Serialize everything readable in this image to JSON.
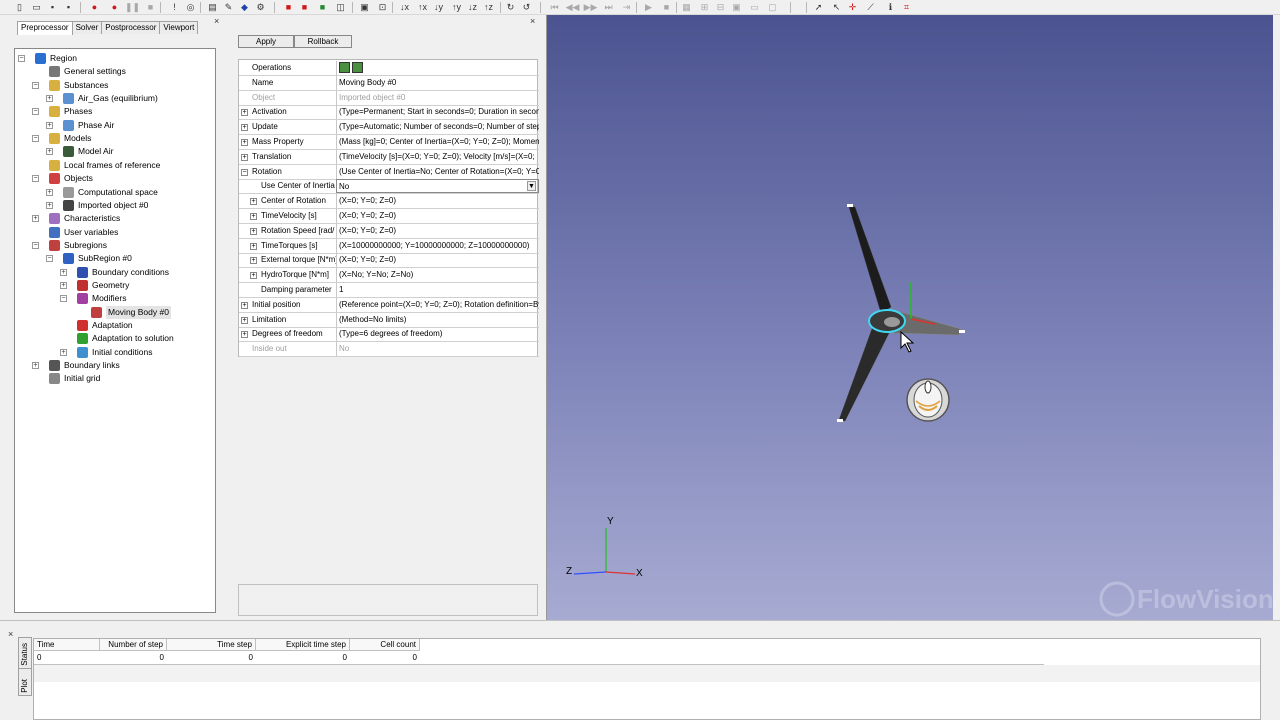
{
  "toolbar": {
    "icons": [
      "new-file",
      "open-folder",
      "save",
      "save-all",
      "stop-red",
      "record",
      "pause",
      "stop",
      "help",
      "globe",
      "copy",
      "tools",
      "cube-blue",
      "settings",
      "red-box",
      "red-box-2",
      "green-box",
      "layers",
      "frame",
      "zoom-fit",
      "x-minus",
      "x-plus",
      "y-minus",
      "y-plus",
      "z-minus",
      "z-plus",
      "rotate-x",
      "rotate-y",
      "first",
      "prev",
      "next",
      "last",
      "fast-forward",
      "play",
      "stop-play",
      "grid",
      "in",
      "out",
      "camera",
      "monitor",
      "window",
      "cursor",
      "pointer",
      "probe",
      "line-tool",
      "info",
      "pixel"
    ]
  },
  "left_panel": {
    "tabs": [
      {
        "label": "Preprocessor",
        "active": true
      },
      {
        "label": "Solver",
        "active": false
      },
      {
        "label": "Postprocessor",
        "active": false
      },
      {
        "label": "Viewport",
        "active": false
      }
    ],
    "tree": [
      {
        "label": "Region",
        "icon": "region-icon",
        "level": 0,
        "expander": "-"
      },
      {
        "label": "General settings",
        "icon": "settings-icon",
        "level": 1,
        "expander": ""
      },
      {
        "label": "Substances",
        "icon": "folder-icon",
        "level": 1,
        "expander": "-"
      },
      {
        "label": "Air_Gas (equilibrium)",
        "icon": "substance-icon",
        "level": 2,
        "expander": "+"
      },
      {
        "label": "Phases",
        "icon": "folder-icon",
        "level": 1,
        "expander": "-"
      },
      {
        "label": "Phase Air",
        "icon": "phase-icon",
        "level": 2,
        "expander": "+"
      },
      {
        "label": "Models",
        "icon": "folder-icon",
        "level": 1,
        "expander": "-"
      },
      {
        "label": "Model Air",
        "icon": "model-icon",
        "level": 2,
        "expander": "+"
      },
      {
        "label": "Local frames of reference",
        "icon": "folder-icon",
        "level": 1,
        "expander": ""
      },
      {
        "label": "Objects",
        "icon": "objects-icon",
        "level": 1,
        "expander": "-"
      },
      {
        "label": "Computational space",
        "icon": "box-icon",
        "level": 2,
        "expander": "+"
      },
      {
        "label": "Imported object #0",
        "icon": "mesh-icon",
        "level": 2,
        "expander": "+"
      },
      {
        "label": "Characteristics",
        "icon": "chart-icon",
        "level": 1,
        "expander": "+"
      },
      {
        "label": "User variables",
        "icon": "variable-icon",
        "level": 1,
        "expander": ""
      },
      {
        "label": "Subregions",
        "icon": "subregions-icon",
        "level": 1,
        "expander": "-"
      },
      {
        "label": "SubRegion #0",
        "icon": "subregion-icon",
        "level": 2,
        "expander": "-"
      },
      {
        "label": "Boundary conditions",
        "icon": "boundary-icon",
        "level": 3,
        "expander": "+"
      },
      {
        "label": "Geometry",
        "icon": "geometry-icon",
        "level": 3,
        "expander": "+"
      },
      {
        "label": "Modifiers",
        "icon": "modifier-icon",
        "level": 3,
        "expander": "-"
      },
      {
        "label": "Moving Body #0",
        "icon": "moving-body-icon",
        "level": 4,
        "expander": "",
        "selected": true
      },
      {
        "label": "Adaptation",
        "icon": "adaptation-icon",
        "level": 3,
        "expander": ""
      },
      {
        "label": "Adaptation to solution",
        "icon": "adaptation-solution-icon",
        "level": 3,
        "expander": ""
      },
      {
        "label": "Initial conditions",
        "icon": "initial-icon",
        "level": 3,
        "expander": "+"
      },
      {
        "label": "Boundary links",
        "icon": "link-icon",
        "level": 1,
        "expander": "+"
      },
      {
        "label": "Initial grid",
        "icon": "grid-icon",
        "level": 1,
        "expander": ""
      }
    ]
  },
  "properties": {
    "apply_label": "Apply",
    "rollback_label": "Rollback",
    "rows": [
      {
        "name": "Operations",
        "value": "",
        "level": 0,
        "expander": "",
        "icons": true
      },
      {
        "name": "Name",
        "value": "Moving Body #0",
        "level": 0,
        "expander": ""
      },
      {
        "name": "Object",
        "value": "Imported object #0",
        "level": 0,
        "expander": "",
        "disabled": true
      },
      {
        "name": "Activation",
        "value": "(Type=Permanent; Start in seconds=0; Duration in secon",
        "level": 0,
        "expander": "+"
      },
      {
        "name": "Update",
        "value": "(Type=Automatic; Number of seconds=0; Number of step",
        "level": 0,
        "expander": "+"
      },
      {
        "name": "Mass Property",
        "value": "(Mass [kg]=0; Center of Inertia=(X=0; Y=0; Z=0); Moment",
        "level": 0,
        "expander": "+"
      },
      {
        "name": "Translation",
        "value": "(TimeVelocity [s]=(X=0; Y=0; Z=0); Velocity [m/s]=(X=0;",
        "level": 0,
        "expander": "+"
      },
      {
        "name": "Rotation",
        "value": "(Use Center of Inertia=No; Center of Rotation=(X=0; Y=0",
        "level": 0,
        "expander": "-"
      },
      {
        "name": "Use Center of Inertia",
        "value": "No",
        "level": 1,
        "expander": "",
        "dropdown": true
      },
      {
        "name": "Center of Rotation",
        "value": "(X=0; Y=0; Z=0)",
        "level": 1,
        "expander": "+"
      },
      {
        "name": "TimeVelocity [s]",
        "value": "(X=0; Y=0; Z=0)",
        "level": 1,
        "expander": "+"
      },
      {
        "name": "Rotation Speed  [rad/",
        "value": "(X=0; Y=0; Z=0)",
        "level": 1,
        "expander": "+"
      },
      {
        "name": "TimeTorques [s]",
        "value": "(X=10000000000; Y=10000000000; Z=10000000000)",
        "level": 1,
        "expander": "+"
      },
      {
        "name": "External torque [N*m]",
        "value": "(X=0; Y=0; Z=0)",
        "level": 1,
        "expander": "+"
      },
      {
        "name": "HydroTorque [N*m]",
        "value": "(X=No; Y=No; Z=No)",
        "level": 1,
        "expander": "+"
      },
      {
        "name": "Damping parameter",
        "value": "1",
        "level": 1,
        "expander": ""
      },
      {
        "name": "Initial position",
        "value": "(Reference point=(X=0; Y=0; Z=0); Rotation definition=By",
        "level": 0,
        "expander": "+"
      },
      {
        "name": "Limitation",
        "value": "(Method=No limits)",
        "level": 0,
        "expander": "+"
      },
      {
        "name": "Degrees of freedom",
        "value": "(Type=6 degrees of freedom)",
        "level": 0,
        "expander": "+"
      },
      {
        "name": "Inside out",
        "value": "No",
        "level": 0,
        "expander": "",
        "disabled": true
      }
    ]
  },
  "viewport": {
    "axes": {
      "y": "Y",
      "z": "Z",
      "x": "X"
    },
    "watermark": "FlowVision",
    "colors": {
      "bg_top": "#4b5390",
      "bg_bottom": "#a7abd2",
      "axis_x": "#e03030",
      "axis_y": "#20c020",
      "axis_z": "#3050ff",
      "highlight": "#40d8f0"
    }
  },
  "bottom": {
    "tabs": [
      "Status",
      "Plot"
    ],
    "columns": [
      {
        "label": "Time",
        "value": "0"
      },
      {
        "label": "Number of step",
        "value": "0"
      },
      {
        "label": "Time step",
        "value": "0"
      },
      {
        "label": "Explicit time step",
        "value": "0"
      },
      {
        "label": "Cell count",
        "value": "0"
      }
    ]
  }
}
